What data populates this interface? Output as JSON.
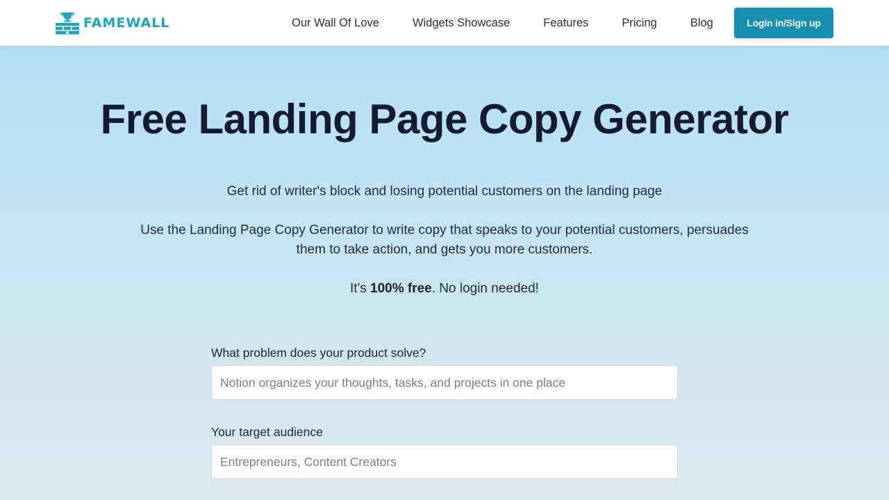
{
  "brand": {
    "name": "FAMEWALL",
    "color": "#1aa6bf",
    "logo_icon": "trophy-wall-icon"
  },
  "nav": {
    "links": [
      {
        "label": "Our Wall Of Love"
      },
      {
        "label": "Widgets Showcase"
      },
      {
        "label": "Features"
      },
      {
        "label": "Pricing"
      },
      {
        "label": "Blog"
      }
    ],
    "login_label": "Login in/Sign up",
    "login_color": "#178fb0"
  },
  "hero": {
    "title": "Free Landing Page Copy Generator",
    "line1": "Get rid of writer's block and losing potential customers on the landing page",
    "line2": "Use the Landing Page Copy Generator to write copy that speaks to your potential customers, persuades them to take action, and gets you more customers.",
    "line3_prefix": "It's ",
    "line3_bold": "100% free",
    "line3_suffix": ". No login needed!"
  },
  "form": {
    "problem_label": "What problem does your product solve?",
    "problem_placeholder": "Notion organizes your thoughts, tasks, and projects in one place",
    "problem_value": "",
    "audience_label": "Your target audience",
    "audience_placeholder": "Entrepreneurs, Content Creators",
    "audience_value": ""
  }
}
